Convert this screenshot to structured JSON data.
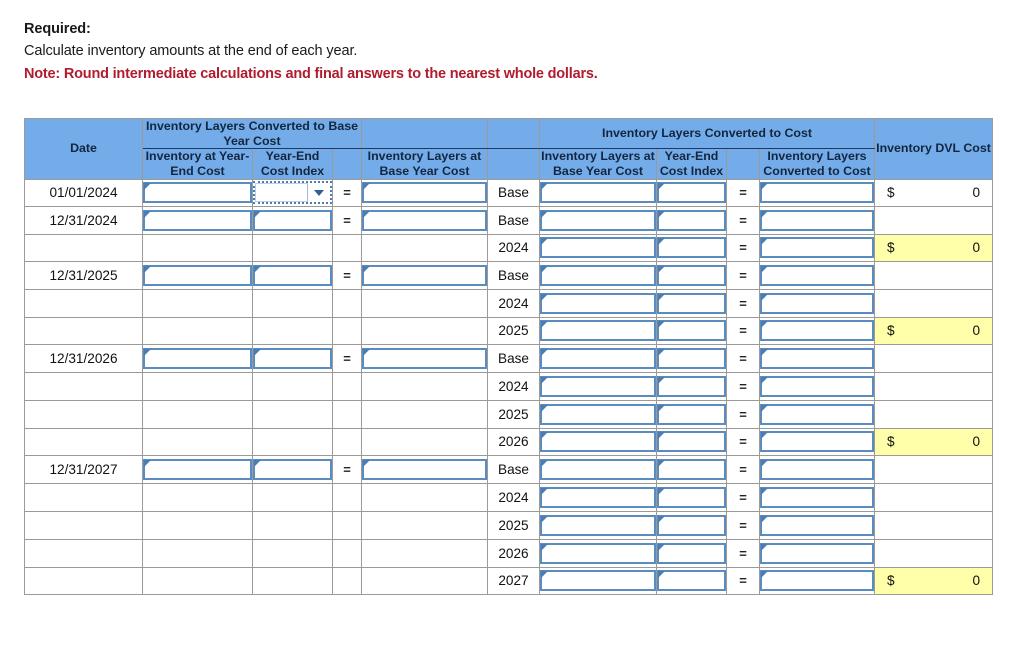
{
  "prompt": {
    "required_label": "Required:",
    "instruction": "Calculate inventory amounts at the end of each year.",
    "note": "Note: Round intermediate calculations and final answers to the nearest whole dollars.",
    "note_color": "#b01c2e"
  },
  "table": {
    "header": {
      "date": "Date",
      "group_base_year": "Inventory Layers Converted to Base Year Cost",
      "group_cost": "Inventory Layers Converted to Cost",
      "group_dvl": "Inventory DVL Cost",
      "sub_inventory_at_year_end_cost": "Inventory at Year-End Cost",
      "sub_year_end_cost_index_1": "Year-End Cost Index",
      "sub_inventory_layers_base_year_cost_1": "Inventory Layers at Base Year Cost",
      "sub_inventory_layers_base_year_cost_2": "Inventory Layers at Base Year Cost",
      "sub_year_end_cost_index_2": "Year-End Cost Index",
      "sub_inventory_layers_converted_to_cost": "Inventory Layers Converted to Cost"
    },
    "equals_symbol": "=",
    "currency_symbol": "$",
    "colors": {
      "header_blue": "#74ace9",
      "highlight_yellow": "#ffffaa",
      "input_border": "#5b8cc0",
      "grid_line": "#9a9a9a"
    },
    "rows": [
      {
        "date": "01/01/2024",
        "layer": "Base",
        "left_inputs": true,
        "left_index_selected": true,
        "right_inputs": true,
        "dvl_value": "0",
        "dvl_highlight": false,
        "dvl_show": true
      },
      {
        "date": "12/31/2024",
        "layer": "Base",
        "left_inputs": true,
        "left_index_selected": false,
        "right_inputs": true,
        "dvl_value": "",
        "dvl_highlight": false,
        "dvl_show": false
      },
      {
        "date": "",
        "layer": "2024",
        "left_inputs": false,
        "left_index_selected": false,
        "right_inputs": true,
        "dvl_value": "0",
        "dvl_highlight": true,
        "dvl_show": true
      },
      {
        "date": "12/31/2025",
        "layer": "Base",
        "left_inputs": true,
        "left_index_selected": false,
        "right_inputs": true,
        "dvl_value": "",
        "dvl_highlight": false,
        "dvl_show": false
      },
      {
        "date": "",
        "layer": "2024",
        "left_inputs": false,
        "left_index_selected": false,
        "right_inputs": true,
        "dvl_value": "",
        "dvl_highlight": false,
        "dvl_show": false
      },
      {
        "date": "",
        "layer": "2025",
        "left_inputs": false,
        "left_index_selected": false,
        "right_inputs": true,
        "dvl_value": "0",
        "dvl_highlight": true,
        "dvl_show": true
      },
      {
        "date": "12/31/2026",
        "layer": "Base",
        "left_inputs": true,
        "left_index_selected": false,
        "right_inputs": true,
        "dvl_value": "",
        "dvl_highlight": false,
        "dvl_show": false
      },
      {
        "date": "",
        "layer": "2024",
        "left_inputs": false,
        "left_index_selected": false,
        "right_inputs": true,
        "dvl_value": "",
        "dvl_highlight": false,
        "dvl_show": false
      },
      {
        "date": "",
        "layer": "2025",
        "left_inputs": false,
        "left_index_selected": false,
        "right_inputs": true,
        "dvl_value": "",
        "dvl_highlight": false,
        "dvl_show": false
      },
      {
        "date": "",
        "layer": "2026",
        "left_inputs": false,
        "left_index_selected": false,
        "right_inputs": true,
        "dvl_value": "0",
        "dvl_highlight": true,
        "dvl_show": true
      },
      {
        "date": "12/31/2027",
        "layer": "Base",
        "left_inputs": true,
        "left_index_selected": false,
        "right_inputs": true,
        "dvl_value": "",
        "dvl_highlight": false,
        "dvl_show": false
      },
      {
        "date": "",
        "layer": "2024",
        "left_inputs": false,
        "left_index_selected": false,
        "right_inputs": true,
        "dvl_value": "",
        "dvl_highlight": false,
        "dvl_show": false
      },
      {
        "date": "",
        "layer": "2025",
        "left_inputs": false,
        "left_index_selected": false,
        "right_inputs": true,
        "dvl_value": "",
        "dvl_highlight": false,
        "dvl_show": false
      },
      {
        "date": "",
        "layer": "2026",
        "left_inputs": false,
        "left_index_selected": false,
        "right_inputs": true,
        "dvl_value": "",
        "dvl_highlight": false,
        "dvl_show": false
      },
      {
        "date": "",
        "layer": "2027",
        "left_inputs": false,
        "left_index_selected": false,
        "right_inputs": true,
        "dvl_value": "0",
        "dvl_highlight": true,
        "dvl_show": true
      }
    ]
  }
}
